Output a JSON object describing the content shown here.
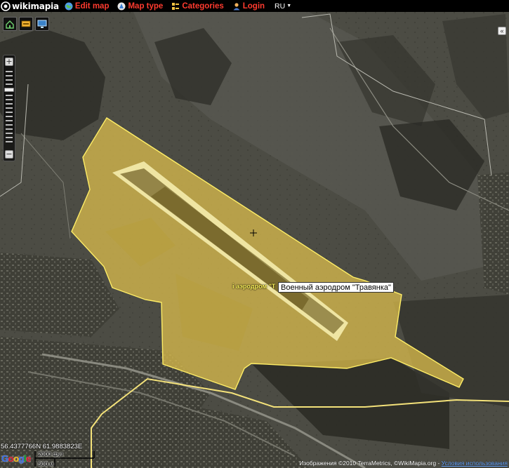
{
  "topbar": {
    "logo_text": "wikimapia",
    "nav": [
      {
        "label": "Edit map",
        "icon": "edit-globe-icon"
      },
      {
        "label": "Map type",
        "icon": "map-type-icon"
      },
      {
        "label": "Categories",
        "icon": "categories-icon"
      },
      {
        "label": "Login",
        "icon": "login-user-icon"
      }
    ],
    "language": "RU"
  },
  "toolbar": {
    "buttons": [
      {
        "icon": "home-location-icon"
      },
      {
        "icon": "tag-icon"
      },
      {
        "icon": "monitor-icon"
      }
    ]
  },
  "zoom": {
    "plus": "+",
    "minus": "−",
    "level_fraction": 0.3
  },
  "collapse": {
    "symbol": "«"
  },
  "map": {
    "place_label": "і аэродром \"Т",
    "tooltip": "Военный аэродром \"Травянка\"",
    "highlight_color": "#d6b94b",
    "border_color": "#ffee66",
    "cursor_symbol": "+"
  },
  "footer": {
    "coordinates": "56.4377766N 61.9883823E",
    "google_logo": "Google",
    "scale_ft": "2000 фут",
    "scale_m": "500 м",
    "attribution": "Изображения ©2010 TerraMetrics, ©WikiMapia.org - ",
    "terms_link": "Условия использования"
  },
  "colors": {
    "nav_red": "#ff3b2f",
    "topbar_bg": "#000000",
    "tooltip_bg": "#ffffff"
  }
}
